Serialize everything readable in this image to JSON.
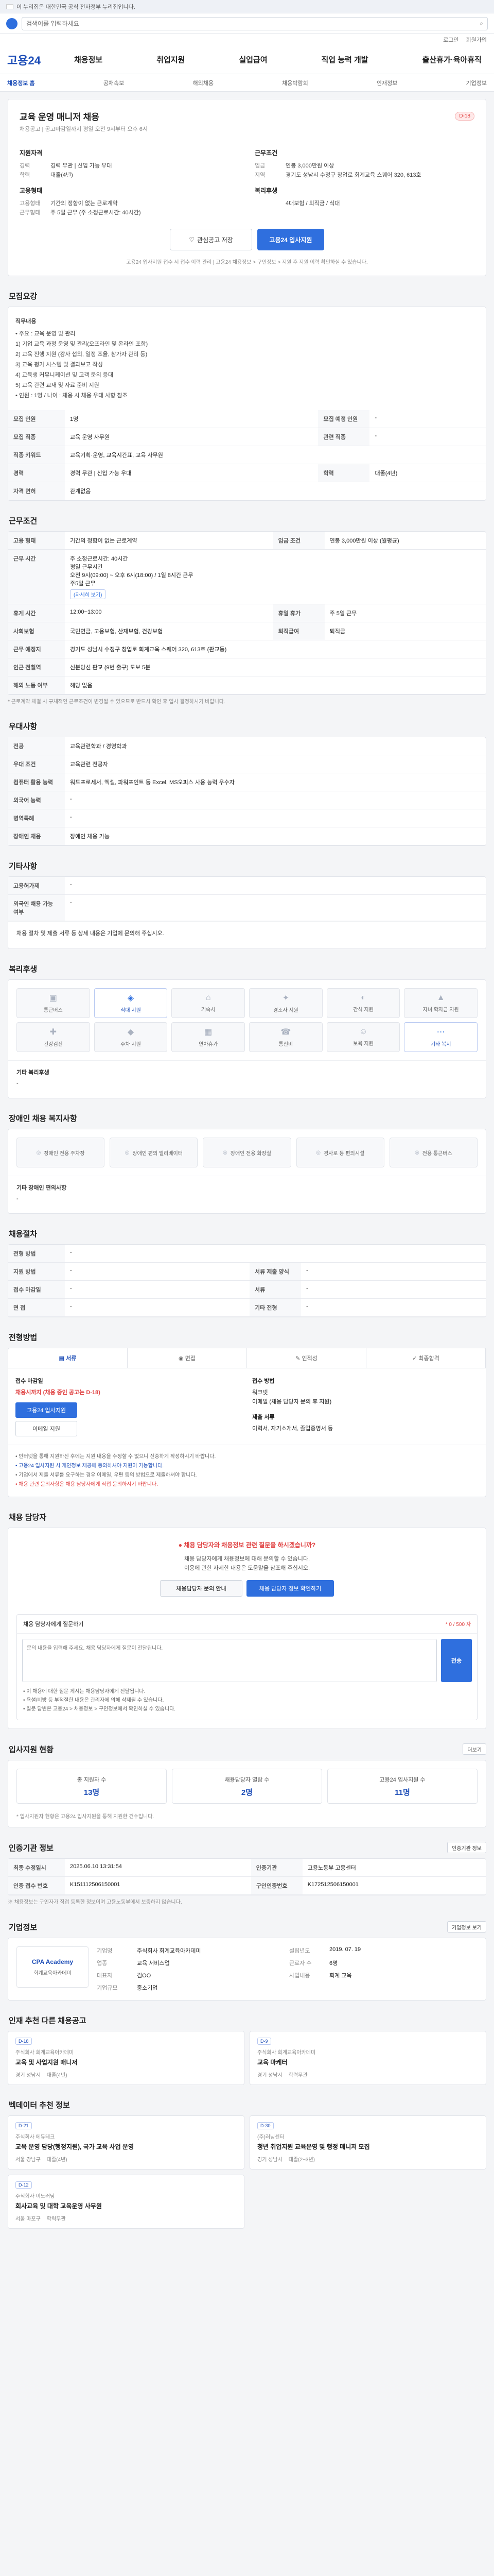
{
  "gov_bar": {
    "text": "이 누리집은 대한민국 공식 전자정부 누리집입니다."
  },
  "search": {
    "placeholder": "검색어를 입력하세요"
  },
  "util": [
    "로그인",
    "회원가입"
  ],
  "header": {
    "brand": "고용24",
    "gnb": [
      "채용정보",
      "취업지원",
      "실업급여",
      "직업 능력 개발",
      "출산휴가·육아휴직"
    ]
  },
  "subtabs": [
    "채용정보 홈",
    "공채속보",
    "해외채용",
    "채용박람회",
    "인재정보",
    "기업정보"
  ],
  "summary": {
    "title": "교육 운영 매니저 채용",
    "badge": "D-18",
    "sub": "채용공고 | 공고마감일까지 평일 오전 9시부터 오후 6시",
    "left_head": "지원자격",
    "left_rows": [
      {
        "k": "경력",
        "v": "경력 무관 | 신입 가능 우대"
      },
      {
        "k": "학력",
        "v": "대졸(4년)"
      }
    ],
    "left_head2": "고용형태",
    "left_rows2": [
      {
        "k": "고용형태",
        "v": "기간의 정함이 없는 근로계약"
      },
      {
        "k": "근무형태",
        "v": "주 5일 근무 (주 소정근로시간: 40시간)"
      }
    ],
    "right_head": "근무조건",
    "right_rows": [
      {
        "k": "임금",
        "v": "연봉 3,000만원 이상"
      },
      {
        "k": "지역",
        "v": "경기도 성남시 수정구 창업로 회계교육 스퀘어 320, 613호"
      }
    ],
    "right_head2": "복리후생",
    "right_rows2": [
      {
        "k": "",
        "v": "4대보험 / 퇴직금 / 식대"
      }
    ],
    "btn_interest": "관심공고 저장",
    "btn_apply": "고용24 입사지원",
    "note": "고용24 입사지원 접수 시 접수 이력 관리 | 고용24 채용정보 > 구인정보 > 지원 후 지원 이력 확인하실 수 있습니다."
  },
  "recruit": {
    "title": "모집요강",
    "job_desc_label": "직무내용",
    "job_desc_lines": [
      "• 주요 : 교육 운영 및 관리",
      "1) 기업 교육 과정 운영 및 관리(오프라인 및 온라인 포함)",
      "2) 교육 진행 지원 (강사 섭외, 일정 조율, 참가자 관리 등)",
      "3) 교육 평가 시스템 및 결과보고 작성",
      "4) 교육생 커뮤니케이션 및 고객 문의 응대",
      "5) 교육 관련 교재 및 자료 준비 지원",
      "• 인원 : 1명 / 나이 : 채용 시 채용 우대 사항 참조"
    ],
    "rows": [
      {
        "k1": "모집 인원",
        "v1": "1명",
        "k2": "모집 예정 인원",
        "v2": "-"
      },
      {
        "k1": "모집 직종",
        "v1": "교육 운영 사무원",
        "k2": "관련 직종",
        "v2": "-"
      },
      {
        "k1": "직종 키워드",
        "v1": "교육기획·운영, 교육시간표, 교육 사무원",
        "k2": "",
        "v2": ""
      },
      {
        "k1": "경력",
        "v1": "경력 무관 | 신입 가능 우대",
        "k2": "학력",
        "v2": "대졸(4년)"
      },
      {
        "k1": "자격 면허",
        "v1": "관계없음",
        "k2": "",
        "v2": ""
      }
    ]
  },
  "conditions": {
    "title": "근무조건",
    "rows": [
      {
        "k1": "고용 형태",
        "v1": "기간의 정함이 없는 근로계약",
        "k2": "임금 조건",
        "v2": "연봉 3,000만원 이상 (월평균)"
      }
    ],
    "work_label": "근무 시간",
    "work_lines": [
      "주 소정근로시간: 40시간",
      "평일 근무시간",
      "오전 9시(09:00) ~ 오후 6시(18:00) / 1일 8시간 근무",
      "주5일 근무"
    ],
    "work_chip": "(자세히 보기)",
    "rows2": [
      {
        "k1": "휴게 시간",
        "v1": "12:00~13:00",
        "k2": "휴일 휴가",
        "v2": "주 5일 근무"
      },
      {
        "k1": "사회보험",
        "v1": "국민연금, 고용보험, 산재보험, 건강보험",
        "k2": "퇴직급여",
        "v2": "퇴직금"
      },
      {
        "k1": "근무 예정지",
        "v1": "경기도 성남시 수정구 창업로 회계교육 스퀘어 320, 613호 (판교동)",
        "k2": "",
        "v2": ""
      },
      {
        "k1": "인근 전철역",
        "v1": "신분당선 판교 (9번 출구) 도보 5분",
        "k2": "",
        "v2": ""
      },
      {
        "k1": "해외 노동 여부",
        "v1": "해당 없음",
        "k2": "",
        "v2": ""
      }
    ],
    "note": "* 근로계약 체결 시 구체적인 근로조건이 변경될 수 있으므로 반드시 확인 후 입사 결정하시기 바랍니다."
  },
  "prefer": {
    "title": "우대사항",
    "rows": [
      {
        "k": "전공",
        "v": "교육관련학과 / 경영학과"
      },
      {
        "k": "우대 조건",
        "v": "교육관련 전공자"
      },
      {
        "k": "컴퓨터 활용 능력",
        "v": "워드프로세서, 엑셀, 파워포인트 등 Excel, MS오피스 사용 능력 우수자"
      },
      {
        "k": "외국어 능력",
        "v": "-"
      },
      {
        "k": "병역특례",
        "v": "-"
      },
      {
        "k": "장애인 채용",
        "v": "장애인 채용 가능"
      }
    ]
  },
  "other": {
    "title": "기타사항",
    "rows": [
      {
        "k": "고용허가제",
        "v": "-"
      },
      {
        "k": "외국인 채용 가능 여부",
        "v": "-"
      }
    ],
    "apply_detail": "채용 절차 및 제출 서류 등 상세 내용은 기업에 문의해 주십시오."
  },
  "benefits": {
    "title": "복리후생",
    "items": [
      {
        "icon": "bus-icon",
        "glyph": "▣",
        "label": "통근버스",
        "on": false
      },
      {
        "icon": "meal-icon",
        "glyph": "◈",
        "label": "식대 지원",
        "on": true
      },
      {
        "icon": "home-icon",
        "glyph": "⌂",
        "label": "기숙사",
        "on": false
      },
      {
        "icon": "gift-icon",
        "glyph": "✦",
        "label": "경조사 지원",
        "on": false
      },
      {
        "icon": "coffee-icon",
        "glyph": "◐",
        "label": "간식 지원",
        "on": false
      },
      {
        "icon": "graduation-icon",
        "glyph": "▲",
        "label": "자녀 학자금 지원",
        "on": false
      },
      {
        "icon": "medical-icon",
        "glyph": "✚",
        "label": "건강검진",
        "on": false
      },
      {
        "icon": "car-icon",
        "glyph": "◆",
        "label": "주차 지원",
        "on": false
      },
      {
        "icon": "calendar-icon",
        "glyph": "▦",
        "label": "연차휴가",
        "on": false
      },
      {
        "icon": "phone-icon",
        "glyph": "☎",
        "label": "통신비",
        "on": false
      },
      {
        "icon": "child-icon",
        "glyph": "☺",
        "label": "보육 지원",
        "on": false
      },
      {
        "icon": "etc-icon",
        "glyph": "⋯",
        "label": "기타 복지",
        "on": true
      }
    ],
    "etc_label": "기타 복리후생",
    "etc_value": "-"
  },
  "disability": {
    "title": "장애인 채용 복지사항",
    "items": [
      {
        "icon": "wheelchair-icon",
        "label": "장애인 전용 주차장"
      },
      {
        "icon": "elevator-icon",
        "label": "장애인 편의 엘리베이터"
      },
      {
        "icon": "toilet-icon",
        "label": "장애인 전용 화장실"
      },
      {
        "icon": "ramp-icon",
        "label": "경사로 등 편의시설"
      },
      {
        "icon": "bus-icon",
        "label": "전용 통근버스"
      }
    ],
    "etc_label": "기타 장애인 편의사항",
    "etc_value": "-"
  },
  "process": {
    "title": "채용절차",
    "rows": [
      {
        "k1": "전형 방법",
        "v1": "-",
        "k2": "",
        "v2": ""
      },
      {
        "k1": "지원 방법",
        "v1": "-",
        "k2": "서류 제출 양식",
        "v2": "-"
      },
      {
        "k1": "접수 마감일",
        "v1": "-",
        "k2": "서류",
        "v2": "-"
      },
      {
        "k1": "면 접",
        "v1": "-",
        "k2": "기타 전형",
        "v2": "-"
      }
    ]
  },
  "apply": {
    "title": "전형방법",
    "btn": "지원 방법",
    "tabs": [
      "서류",
      "면접",
      "인적성",
      "최종합격"
    ],
    "left_label": "접수 마감일",
    "left_value": "채용시까지 (채용 중인 공고는 D-18)",
    "btn_apply": "고용24 입사지원",
    "btn_email": "이메일 지원",
    "right_label": "접수 방법",
    "right_lines": [
      "워크넷",
      "이메일 (채용 담당자 문의 후 지원)"
    ],
    "right_label2": "제출 서류",
    "right_value2": "이력서, 자기소개서, 졸업증명서 등",
    "bullets": [
      "• 인터넷을 통해 지원하신 후에는 지원 내용을 수정할 수 없으니 신중하게 작성하시기 바랍니다.",
      "• 고용24 입사지원 시 개인정보 제공에 동의하셔야 지원이 가능합니다.",
      "• 기업에서 제출 서류를 요구하는 경우 이메일, 우편 등의 방법으로 제출하셔야 합니다.",
      "• 채용 관련 문의사항은 채용 담당자에게 직접 문의하시기 바랍니다."
    ]
  },
  "contact": {
    "title": "채용 담당자",
    "red_title": "채용 담당자와 채용정보 관련 질문을 하시겠습니까?",
    "desc1": "채용 담당자에게 채용정보에 대해 문의할 수 있습니다.",
    "desc2": "이용에 관한 자세한 내용은 도움말을 참조해 주십시오.",
    "btn_info": "채용담당자 문의 안내",
    "btn_qa": "채용 담당자 정보 확인하기",
    "qa_label": "채용 담당자에게 질문하기",
    "qa_hint": "* 0 / 500 자",
    "qa_placeholder": "문의 내용을 입력해 주세요. 채용 담당자에게 질문이 전달됩니다.",
    "qa_send": "전송",
    "qa_notes": [
      "• 이 채용에 대한 질문 게시는 채용담당자에게 전달됩니다.",
      "• 욕설/비방 등 부적절한 내용은 관리자에 의해 삭제될 수 있습니다.",
      "• 질문 답변은 고용24 > 채용정보 > 구인정보에서 확인하실 수 있습니다."
    ]
  },
  "stats": {
    "title": "입사지원 현황",
    "btn": "더보기",
    "items": [
      {
        "label": "총 지원자 수",
        "value": "13명"
      },
      {
        "label": "채용담당자 열람 수",
        "value": "2명"
      },
      {
        "label": "고용24 입사지원 수",
        "value": "11명"
      }
    ],
    "note": "* 입사지원자 현황은 고용24 입사지원을 통해 지원한 건수입니다."
  },
  "info": {
    "title": "인증기관 정보",
    "btn": "인증기관 정보",
    "rows": [
      {
        "k1": "최종 수정일시",
        "v1": "2025.06.10 13:31:54",
        "k2": "인증기관",
        "v2": "고용노동부 고용센터"
      },
      {
        "k1": "인증 접수 번호",
        "v1": "K151112506150001",
        "k2": "구인인증번호",
        "v2": "K172512506150001"
      }
    ],
    "note": "※ 채용정보는 구인자가 직접 등록한 정보이며 고용노동부에서 보증하지 않습니다."
  },
  "company": {
    "title": "기업정보",
    "btn": "기업정보 보기",
    "logo_label": "CPA Academy",
    "logo_sub": "회계교육아카데미",
    "fields": [
      {
        "k": "기업명",
        "v": "주식회사 회계교육아카데미"
      },
      {
        "k": "설립년도",
        "v": "2019. 07. 19"
      },
      {
        "k": "업종",
        "v": "교육 서비스업"
      },
      {
        "k": "근로자 수",
        "v": "6명"
      },
      {
        "k": "대표자",
        "v": "김OO"
      },
      {
        "k": "사업내용",
        "v": "회계 교육"
      },
      {
        "k": "기업규모",
        "v": "중소기업"
      },
      {
        "k": "",
        "v": ""
      }
    ]
  },
  "rec_same": {
    "title": "인재 추천 다른 채용공고",
    "items": [
      {
        "tag": "D-18",
        "org": "주식회사 회계교육아카데미",
        "title": "교육 및 사업지원 매니저",
        "meta1": "경기 성남시",
        "meta2": "대졸(4년)"
      },
      {
        "tag": "D-9",
        "org": "주식회사 회계교육아카데미",
        "title": "교육 마케터",
        "meta1": "경기 성남시",
        "meta2": "학력무관"
      }
    ]
  },
  "rec_other": {
    "title": "벡데이터 추천 정보",
    "items": [
      {
        "tag": "D-21",
        "org": "주식회사 에듀테크",
        "title": "교육 운영 담당(행정지원), 국가 교육 사업 운영",
        "meta1": "서울 강남구",
        "meta2": "대졸(4년)"
      },
      {
        "tag": "D-30",
        "org": "(주)러닝센터",
        "title": "청년 취업지원 교육운영 및 행정 매니저 모집",
        "meta1": "경기 성남시",
        "meta2": "대졸(2~3년)"
      },
      {
        "tag": "D-12",
        "org": "주식회사 이노러닝",
        "title": "회사교육 및 대학 교육운영 사무원",
        "meta1": "서울 마포구",
        "meta2": "학력무관"
      }
    ]
  }
}
